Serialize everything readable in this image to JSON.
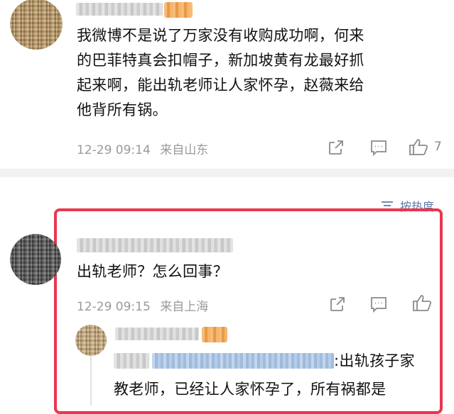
{
  "comment1": {
    "body": [
      "我微博不是说了万家没有收购成功啊，何来",
      "的巴菲特真会扣帽子，新加坡黄有龙最好抓",
      "起来啊，能出轨老师让人家怀孕，赵薇来给",
      "他背所有锅。"
    ],
    "timestamp": "12-29 09:14",
    "location": "来自山东",
    "like_count": "7"
  },
  "sort": {
    "label": "按热度"
  },
  "comment2": {
    "body": "出轨老师？怎么回事？",
    "timestamp": "12-29 09:15",
    "location": "来自上海"
  },
  "reply": {
    "line1_suffix": ":出轨孩子家",
    "line2": "教老师，已经让人家怀孕了，所有祸都是"
  },
  "colors": {
    "highlight_border": "#e8374e",
    "meta_text": "#9a9a9a",
    "link": "#5b7aaa"
  },
  "icons": [
    "share-icon",
    "comment-icon",
    "thumbs-up-icon",
    "sort-icon"
  ]
}
